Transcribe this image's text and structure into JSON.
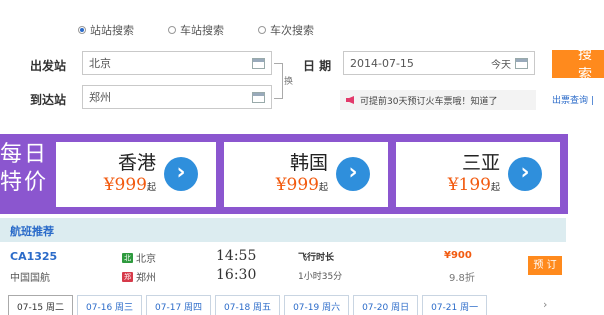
{
  "search": {
    "modes": [
      "站站搜索",
      "车站搜索",
      "车次搜索"
    ],
    "from_label": "出发站",
    "from_value": "北京",
    "to_label": "到达站",
    "to_value": "郑州",
    "swap_label": "换",
    "date_label": "日 期",
    "date_value": "2014-07-15",
    "today_label": "今天",
    "button_label": "搜 索",
    "notice": "可提前30天预订火车票哦！知道了",
    "ticket_link": "出票查询 |"
  },
  "banner": {
    "title": "每日特价",
    "cards": [
      {
        "city": "香港",
        "price": "¥999",
        "suffix": "起"
      },
      {
        "city": "韩国",
        "price": "¥999",
        "suffix": "起"
      },
      {
        "city": "三亚",
        "price": "¥199",
        "suffix": "起"
      }
    ],
    "go_icon": "›",
    "accent": "#8b56cf"
  },
  "recommend": {
    "title": "航班推荐",
    "flight": {
      "number": "CA1325",
      "airline": "中国国航",
      "from_tag": "北",
      "from_city": "北京",
      "to_tag": "郑",
      "to_city": "郑州",
      "depart": "14:55",
      "arrive": "16:30",
      "duration_label": "飞行时长",
      "duration": "1小时35分",
      "price": "¥900",
      "discount": "9.8折",
      "book_label": "预 订"
    }
  },
  "date_tabs": [
    "07-15 周二",
    "07-16 周三",
    "07-17 周四",
    "07-18 周五",
    "07-19 周六",
    "07-20 周日",
    "07-21 周一"
  ],
  "date_next": "›"
}
